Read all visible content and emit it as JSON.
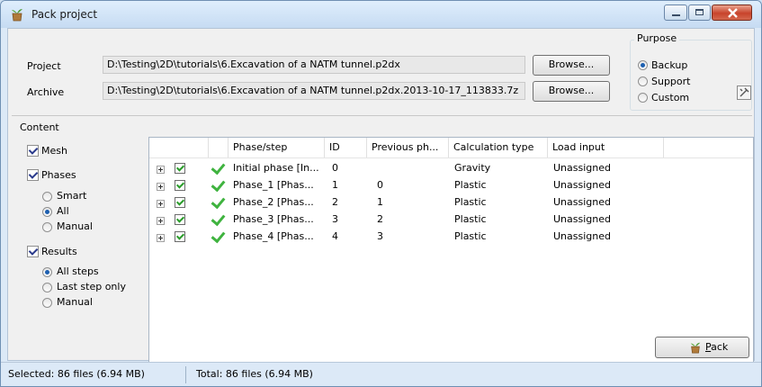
{
  "window": {
    "title": "Pack project"
  },
  "fields": {
    "project_label": "Project",
    "project_path": "D:\\Testing\\2D\\tutorials\\6.Excavation of a NATM tunnel.p2dx",
    "archive_label": "Archive",
    "archive_path": "D:\\Testing\\2D\\tutorials\\6.Excavation of a NATM tunnel.p2dx.2013-10-17_113833.7z",
    "browse_label": "Browse..."
  },
  "purpose": {
    "legend": "Purpose",
    "options": [
      {
        "label": "Backup",
        "selected": true
      },
      {
        "label": "Support",
        "selected": false
      },
      {
        "label": "Custom",
        "selected": false
      }
    ]
  },
  "content": {
    "legend": "Content",
    "mesh": {
      "label": "Mesh",
      "checked": true
    },
    "phases": {
      "label": "Phases",
      "checked": true,
      "options": [
        {
          "label": "Smart",
          "selected": false
        },
        {
          "label": "All",
          "selected": true
        },
        {
          "label": "Manual",
          "selected": false
        }
      ]
    },
    "results": {
      "label": "Results",
      "checked": true,
      "options": [
        {
          "label": "All steps",
          "selected": true
        },
        {
          "label": "Last step only",
          "selected": false
        },
        {
          "label": "Manual",
          "selected": false
        }
      ]
    }
  },
  "table": {
    "columns": [
      "Phase/step",
      "ID",
      "Previous ph...",
      "Calculation type",
      "Load input"
    ],
    "rows": [
      {
        "phase": "Initial phase [In...",
        "id": "0",
        "previous": "",
        "calc_type": "Gravity",
        "load_input": "Unassigned"
      },
      {
        "phase": "Phase_1 [Phas...",
        "id": "1",
        "previous": "0",
        "calc_type": "Plastic",
        "load_input": "Unassigned"
      },
      {
        "phase": "Phase_2 [Phas...",
        "id": "2",
        "previous": "1",
        "calc_type": "Plastic",
        "load_input": "Unassigned"
      },
      {
        "phase": "Phase_3 [Phas...",
        "id": "3",
        "previous": "2",
        "calc_type": "Plastic",
        "load_input": "Unassigned"
      },
      {
        "phase": "Phase_4 [Phas...",
        "id": "4",
        "previous": "3",
        "calc_type": "Plastic",
        "load_input": "Unassigned"
      }
    ]
  },
  "actions": {
    "pack_prefix": "",
    "pack_underlined": "P",
    "pack_rest": "ack"
  },
  "status": {
    "selected": "Selected: 86 files (6.94 MB)",
    "total": "Total: 86 files (6.94 MB)"
  },
  "colors": {
    "accent": "#1d5fb0",
    "check_green": "#3fb33f"
  }
}
